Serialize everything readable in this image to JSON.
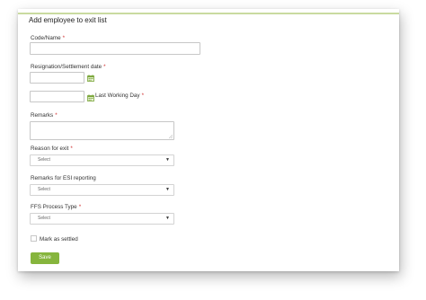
{
  "form": {
    "title": "Add employee to exit list",
    "code_name_label": "Code/Name",
    "resignation_label": "Resignation/Settlement date",
    "last_working_day_label": "Last Working Day",
    "remarks_label": "Remarks",
    "reason_label": "Reason for exit",
    "reason_value": "Select",
    "esi_label": "Remarks for ESI reporting",
    "esi_value": "Select",
    "ffs_label": "FFS Process Type",
    "ffs_value": "Select",
    "mark_settled_label": "Mark as settled",
    "save_label": "Save",
    "required_mark": "*"
  },
  "colors": {
    "accent": "#86b53d",
    "required": "#d03030",
    "top_line": "#c9dba0"
  },
  "icons": {
    "calendar": "calendar-icon",
    "dropdown": "caret-down-icon"
  }
}
